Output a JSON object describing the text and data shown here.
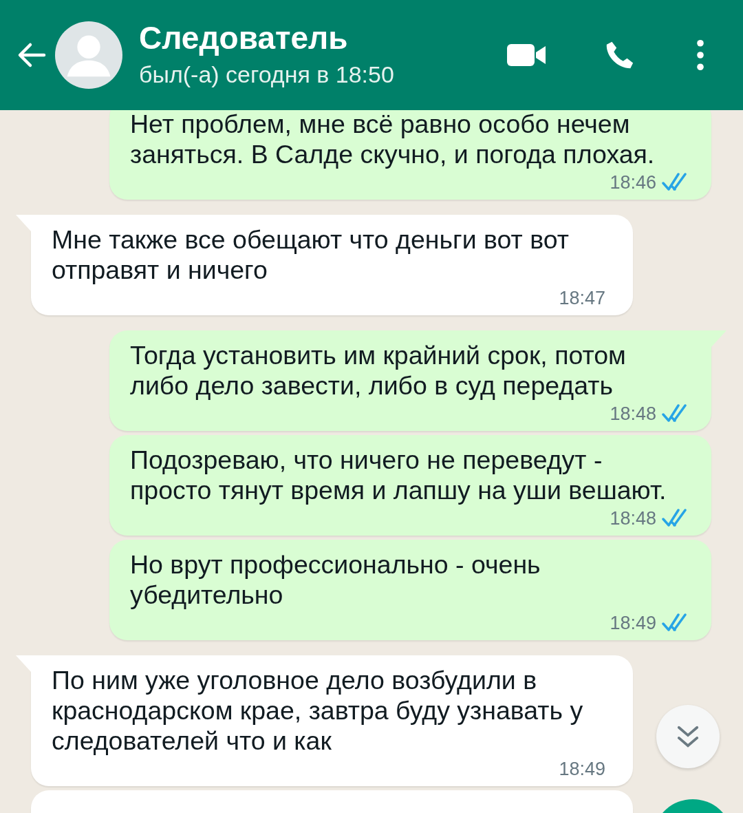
{
  "header": {
    "title": "Следователь",
    "status": "был(-а) сегодня в 18:50"
  },
  "messages": [
    {
      "outgoing": true,
      "text": "Нет проблем, мне всё равно особо нечем заняться. В Салде скучно, и погода плохая.",
      "time": "18:46",
      "read": true,
      "tail": false
    },
    {
      "outgoing": false,
      "text": "Мне также все обещают что деньги вот вот отправят и ничего",
      "time": "18:47",
      "tail": true
    },
    {
      "outgoing": true,
      "text": "Тогда установить им крайний срок, потом либо дело завести, либо в суд передать",
      "time": "18:48",
      "read": true,
      "tail": true
    },
    {
      "outgoing": true,
      "text": "Подозреваю, что ничего не переведут - просто тянут время и лапшу на уши вешают.",
      "time": "18:48",
      "read": true,
      "tail": false
    },
    {
      "outgoing": true,
      "text": "Но врут профессионально - очень убедительно",
      "time": "18:49",
      "read": true,
      "tail": false
    },
    {
      "outgoing": false,
      "text": "По ним уже уголовное дело возбудили в краснодарском крае, завтра буду узнавать у следователей что и как",
      "time": "18:49",
      "tail": true
    },
    {
      "outgoing": false,
      "tail": false
    }
  ]
}
